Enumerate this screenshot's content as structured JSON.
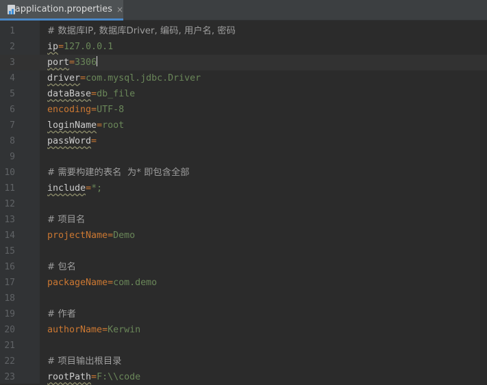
{
  "tab": {
    "label": "application.properties",
    "close": "×"
  },
  "lines": [
    {
      "num": "1",
      "comment": "# 数据库IP, 数据库Driver, 编码, 用户名, 密码"
    },
    {
      "num": "2",
      "key": "ip",
      "eq": "=",
      "value": "127.0.0.1",
      "style": "plain",
      "underline": true
    },
    {
      "num": "3",
      "key": "port",
      "eq": "=",
      "value": "3306",
      "style": "plain",
      "underline": true,
      "caret": true,
      "current": true
    },
    {
      "num": "4",
      "key": "driver",
      "eq": "=",
      "value": "com.mysql.jdbc.Driver",
      "style": "plain",
      "underline": true
    },
    {
      "num": "5",
      "key": "dataBase",
      "eq": "=",
      "value": "db_file",
      "style": "plain",
      "underline": true
    },
    {
      "num": "6",
      "key": "encoding",
      "eq": "=",
      "value": "UTF-8",
      "style": "orange"
    },
    {
      "num": "7",
      "key": "loginName",
      "eq": "=",
      "value": "root",
      "style": "plain",
      "underline": true
    },
    {
      "num": "8",
      "key": "passWord",
      "eq": "=",
      "value": "",
      "style": "plain",
      "underline": true
    },
    {
      "num": "9"
    },
    {
      "num": "10",
      "comment": "# 需要构建的表名  为* 即包含全部"
    },
    {
      "num": "11",
      "key": "include",
      "eq": "=",
      "value": "*;",
      "style": "plain",
      "underline": true
    },
    {
      "num": "12"
    },
    {
      "num": "13",
      "comment": "# 项目名"
    },
    {
      "num": "14",
      "key": "projectName",
      "eq": "=",
      "value": "Demo",
      "style": "orange"
    },
    {
      "num": "15"
    },
    {
      "num": "16",
      "comment": "# 包名"
    },
    {
      "num": "17",
      "key": "packageName",
      "eq": "=",
      "value": "com.demo",
      "style": "orange"
    },
    {
      "num": "18"
    },
    {
      "num": "19",
      "comment": "# 作者"
    },
    {
      "num": "20",
      "key": "authorName",
      "eq": "=",
      "value": "Kerwin",
      "style": "orange"
    },
    {
      "num": "21"
    },
    {
      "num": "22",
      "comment": "# 项目输出根目录"
    },
    {
      "num": "23",
      "key": "rootPath",
      "eq": "=",
      "value": "F:\\\\code",
      "style": "plain",
      "underline": true
    }
  ],
  "colors": {
    "background": "#2b2b2b",
    "gutter": "#313335",
    "tab_active": "#4e5254",
    "tab_underline": "#4a88c7",
    "key_orange": "#cc7832",
    "value_green": "#6a8759",
    "comment": "#9e9e9e"
  },
  "icons": {
    "tab_file": "properties-file-icon"
  }
}
